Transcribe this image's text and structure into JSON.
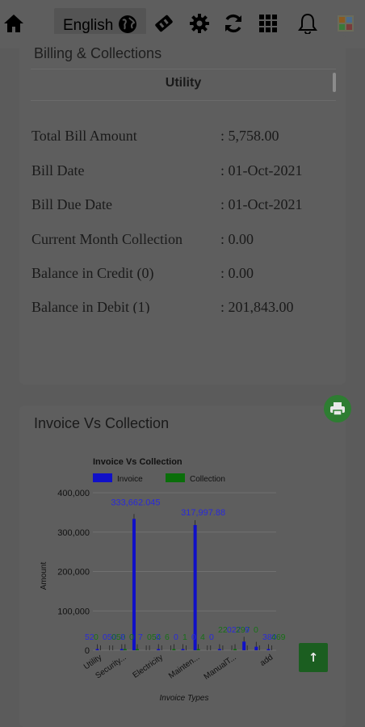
{
  "topbar": {
    "language": "English",
    "icons": [
      "home-icon",
      "globe-icon",
      "ticket-icon",
      "gear-icon",
      "refresh-icon",
      "apps-grid-icon",
      "bell-icon",
      "avatar"
    ]
  },
  "billing": {
    "header": "Billing & Collections",
    "tab": "Utility",
    "rows": [
      {
        "label": "Total Bill Amount",
        "value": ": 5,758.00"
      },
      {
        "label": "Bill Date",
        "value": ": 01-Oct-2021"
      },
      {
        "label": "Bill Due Date",
        "value": ": 01-Oct-2021"
      },
      {
        "label": "Current Month Collection",
        "value": ": 0.00"
      },
      {
        "label": "Balance in Credit (0)",
        "value": ": 0.00"
      },
      {
        "label": "Balance in Debit (1)",
        "value": ": 201,843.00"
      }
    ]
  },
  "invoice_card": {
    "title": "Invoice Vs Collection"
  },
  "colors": {
    "invoice": "#1010c8",
    "collection": "#0a6e0a",
    "print_button": "#2e7d32"
  },
  "chart_data": {
    "type": "bar",
    "title": "Invoice Vs Collection",
    "xlabel": "Invoice Types",
    "ylabel": "Amount",
    "ylim": [
      0,
      400000
    ],
    "yticks": [
      "0",
      "100,000",
      "200,000",
      "300,000",
      "400,000"
    ],
    "categories": [
      "Utility",
      "",
      "Security...",
      "",
      "",
      "Electricity",
      "",
      "",
      "Mainten...",
      "",
      "",
      "ManualT...",
      "",
      "",
      "add"
    ],
    "series": [
      {
        "name": "Invoice",
        "values": [
          520,
          0,
          3000,
          333662.045,
          0,
          800,
          0,
          3000,
          317997.88,
          0,
          1000,
          0,
          22000,
          9000,
          3000
        ]
      },
      {
        "name": "Collection",
        "values": [
          0,
          0,
          500,
          500,
          0,
          0,
          500,
          0,
          600,
          0,
          0,
          400,
          0,
          0,
          0
        ]
      }
    ],
    "data_labels": {
      "top_invoice_1": "333,662.045",
      "top_invoice_2": "317,997.88",
      "small_label_text": "52,0,050,050,8,0,7,054,0,6,0,1,0,4,0,22,027,297,9,0,380,469"
    },
    "legend": "top-left",
    "grid": true
  }
}
